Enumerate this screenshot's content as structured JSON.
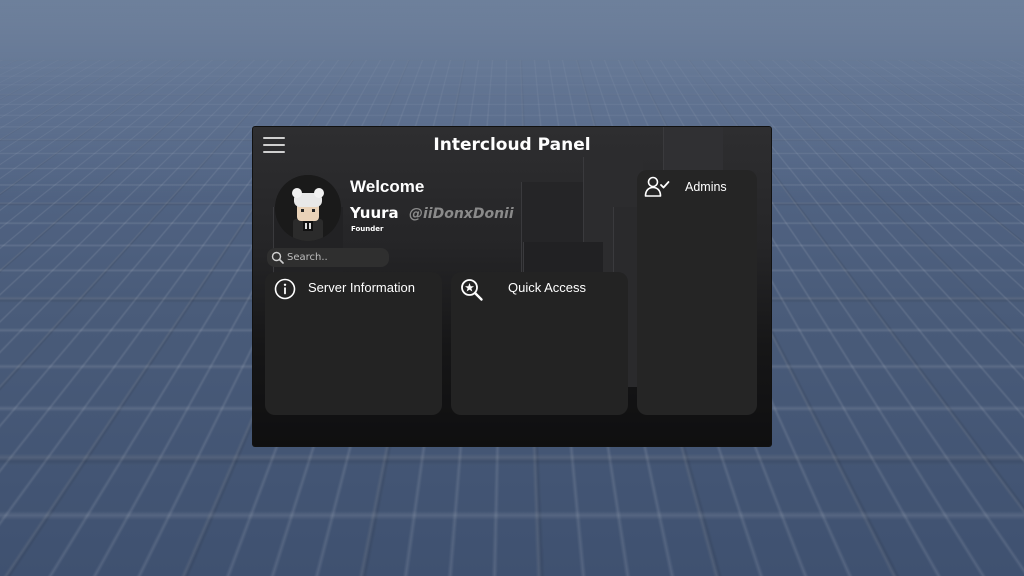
{
  "panel": {
    "title": "Intercloud Panel",
    "welcome": "Welcome",
    "user": {
      "display_name": "Yuura",
      "handle": "@iiDonxDonii",
      "role": "Founder"
    },
    "search": {
      "placeholder": "Search.."
    },
    "cards": {
      "server_information": "Server Information",
      "quick_access": "Quick Access",
      "admins": "Admins"
    }
  },
  "icons": {
    "menu": "hamburger-menu-icon",
    "search": "search-icon",
    "info": "info-circle-icon",
    "quick_access": "star-magnifier-icon",
    "admins": "user-check-icon"
  },
  "colors": {
    "panel_background": "#1e1e1e",
    "card_background": "#232323",
    "text": "#ffffff",
    "handle_text": "#8a8a8a"
  }
}
